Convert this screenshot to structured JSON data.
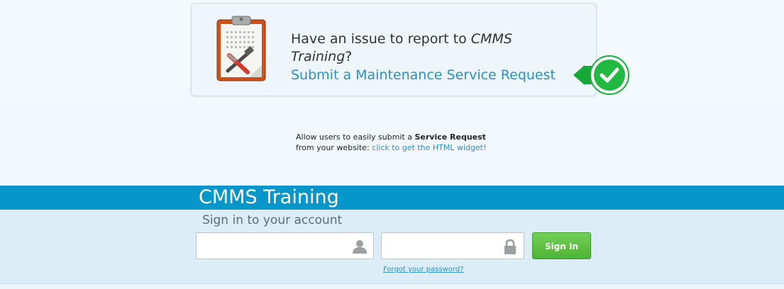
{
  "card": {
    "prompt_prefix": "Have an issue to report to ",
    "org_name": "CMMS Training",
    "prompt_suffix": "?",
    "submit_link": "Submit a Maintenance Service Request",
    "icon": "clipboard-tools-icon",
    "badge_icon": "green-check-icon"
  },
  "widget": {
    "line1_prefix": "Allow users to easily submit a ",
    "line1_bold": "Service Request",
    "line2_prefix": "from your website: ",
    "line2_link": "click to get the HTML widget!"
  },
  "login": {
    "brand": "CMMS Training",
    "heading": "Sign in to your account",
    "username_value": "",
    "password_value": "",
    "username_icon": "user-icon",
    "password_icon": "lock-icon",
    "signin_label": "Sign In",
    "forgot_label": "Forgot your password?"
  },
  "colors": {
    "accent_bar": "#0796c9",
    "link": "#2f8fc4",
    "signin_button": "#5cbd42",
    "badge": "#1cb53c"
  }
}
